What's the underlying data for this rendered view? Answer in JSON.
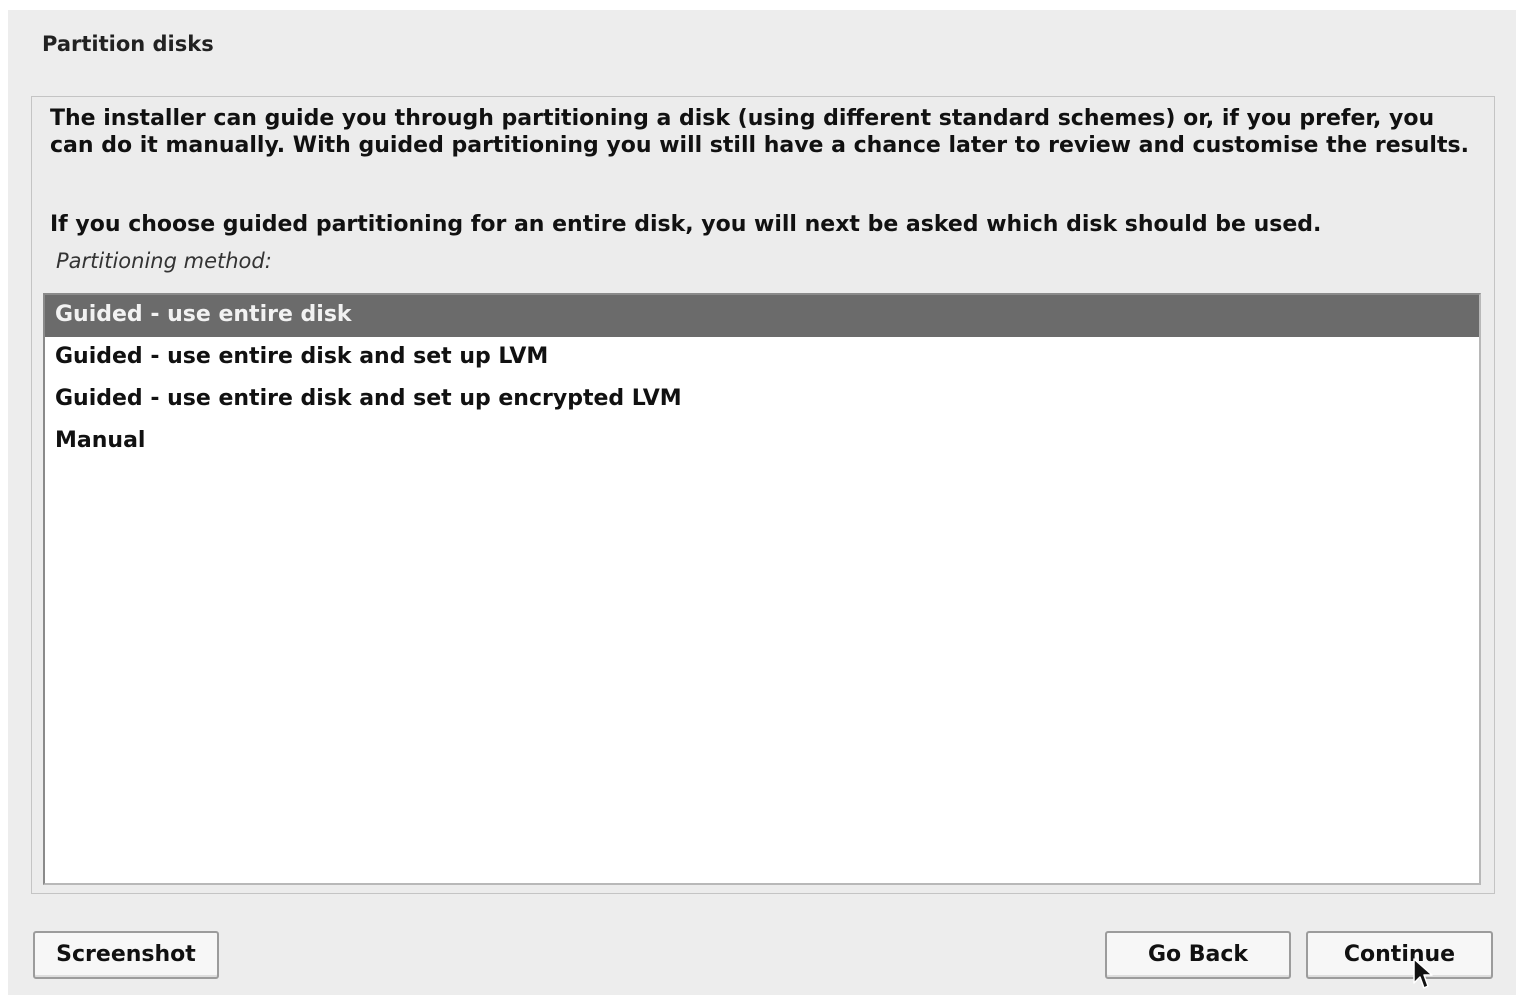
{
  "window": {
    "title": "Partition disks"
  },
  "description": {
    "paragraph1": "The installer can guide you through partitioning a disk (using different standard schemes) or, if you prefer, you can do it manually. With guided partitioning you will still have a chance later to review and customise the results.",
    "paragraph2": "If you choose guided partitioning for an entire disk, you will next be asked which disk should be used.",
    "method_label": "Partitioning method:"
  },
  "partition_methods": {
    "items": [
      {
        "label": "Guided - use entire disk",
        "selected": true
      },
      {
        "label": "Guided - use entire disk and set up LVM",
        "selected": false
      },
      {
        "label": "Guided - use entire disk and set up encrypted LVM",
        "selected": false
      },
      {
        "label": "Manual",
        "selected": false
      }
    ]
  },
  "buttons": {
    "screenshot": "Screenshot",
    "go_back": "Go Back",
    "continue": "Continue"
  },
  "colors": {
    "selection_bg": "#6b6b6b",
    "window_bg": "#ededed",
    "list_bg": "#ffffff"
  },
  "icons": {
    "cursor": "mouse-pointer-icon"
  }
}
